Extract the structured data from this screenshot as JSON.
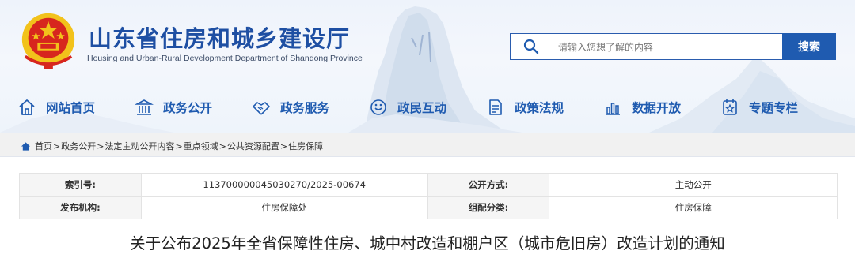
{
  "header": {
    "title": "山东省住房和城乡建设厅",
    "subtitle": "Housing and Urban-Rural Development Department of Shandong Province",
    "emblem_icon": "national-emblem-icon",
    "colors": {
      "brand": "#1f5bb0",
      "emblem_red": "#d7261e",
      "emblem_gold": "#f2c21b"
    }
  },
  "search": {
    "placeholder": "请输入您想了解的内容",
    "button_label": "搜索"
  },
  "nav": {
    "items": [
      {
        "label": "网站首页",
        "icon": "home-icon"
      },
      {
        "label": "政务公开",
        "icon": "government-building-icon"
      },
      {
        "label": "政务服务",
        "icon": "handshake-icon"
      },
      {
        "label": "政民互动",
        "icon": "interaction-icon"
      },
      {
        "label": "政策法规",
        "icon": "document-icon"
      },
      {
        "label": "数据开放",
        "icon": "data-chart-icon"
      },
      {
        "label": "专题专栏",
        "icon": "topic-icon"
      }
    ]
  },
  "breadcrumb": {
    "icon": "home-icon",
    "items": [
      "首页",
      "政务公开",
      "法定主动公开内容",
      "重点领域",
      "公共资源配置",
      "住房保障"
    ],
    "separator": ">"
  },
  "meta": {
    "index_label": "索引号:",
    "index_value": "113700000045030270/2025-00674",
    "publish_mode_label": "公开方式:",
    "publish_mode_value": "主动公开",
    "issuer_label": "发布机构:",
    "issuer_value": "住房保障处",
    "category_label": "组配分类:",
    "category_value": "住房保障"
  },
  "article": {
    "title": "关于公布2025年全省保障性住房、城中村改造和棚户区（城市危旧房）改造计划的通知"
  }
}
